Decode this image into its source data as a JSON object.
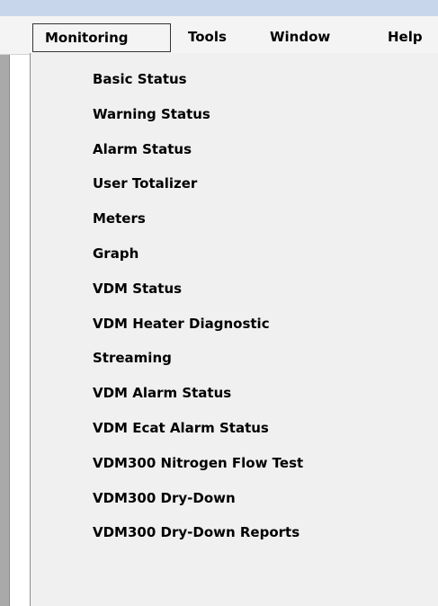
{
  "menubar": {
    "items": [
      {
        "label": "Monitoring",
        "active": true
      },
      {
        "label": "Tools",
        "active": false
      },
      {
        "label": "Window",
        "active": false
      },
      {
        "label": "Help",
        "active": false
      }
    ]
  },
  "monitoring_menu": {
    "items": [
      {
        "label": "Basic Status"
      },
      {
        "label": "Warning Status"
      },
      {
        "label": "Alarm Status"
      },
      {
        "label": "User Totalizer"
      },
      {
        "label": "Meters"
      },
      {
        "label": "Graph"
      },
      {
        "label": "VDM Status"
      },
      {
        "label": "VDM Heater Diagnostic"
      },
      {
        "label": "Streaming"
      },
      {
        "label": "VDM Alarm Status"
      },
      {
        "label": "VDM Ecat Alarm Status"
      },
      {
        "label": "VDM300 Nitrogen Flow Test"
      },
      {
        "label": "VDM300 Dry-Down"
      },
      {
        "label": "VDM300 Dry-Down Reports"
      }
    ]
  },
  "colors": {
    "title_strip": "#c7d6ea",
    "menubar_bg": "#f4f4f4",
    "menu_bg": "#f0f0f0",
    "left_panel": "#a9a9a9",
    "text": "#000000"
  }
}
